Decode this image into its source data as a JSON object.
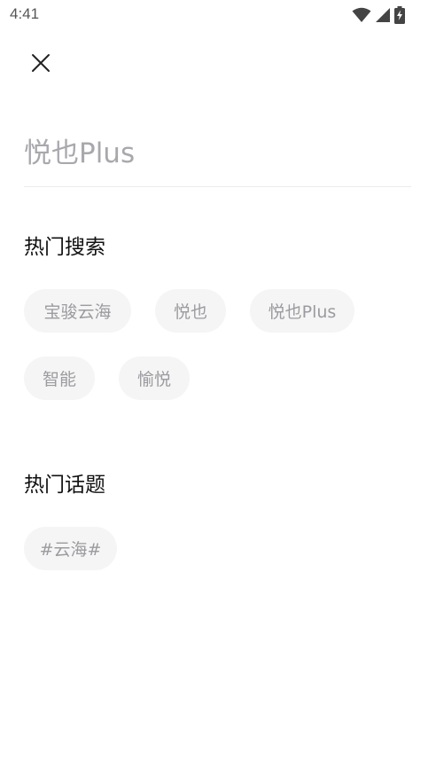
{
  "status_bar": {
    "time": "4:41",
    "icons": [
      "wifi-icon",
      "cellular-signal-icon",
      "battery-charging-icon"
    ]
  },
  "header": {
    "close_icon": "close-icon"
  },
  "search": {
    "placeholder": "悦也Plus",
    "value": ""
  },
  "hot_search": {
    "title": "热门搜索",
    "tags": [
      "宝骏云海",
      "悦也",
      "悦也Plus",
      "智能",
      "愉悦"
    ]
  },
  "hot_topics": {
    "title": "热门话题",
    "tags": [
      "#云海#"
    ]
  },
  "colors": {
    "background": "#ffffff",
    "tag_background": "#f5f5f5",
    "tag_text": "#9b9ba0",
    "placeholder_text": "#a8a8ad",
    "divider": "#ececec",
    "title_text": "#111111"
  }
}
